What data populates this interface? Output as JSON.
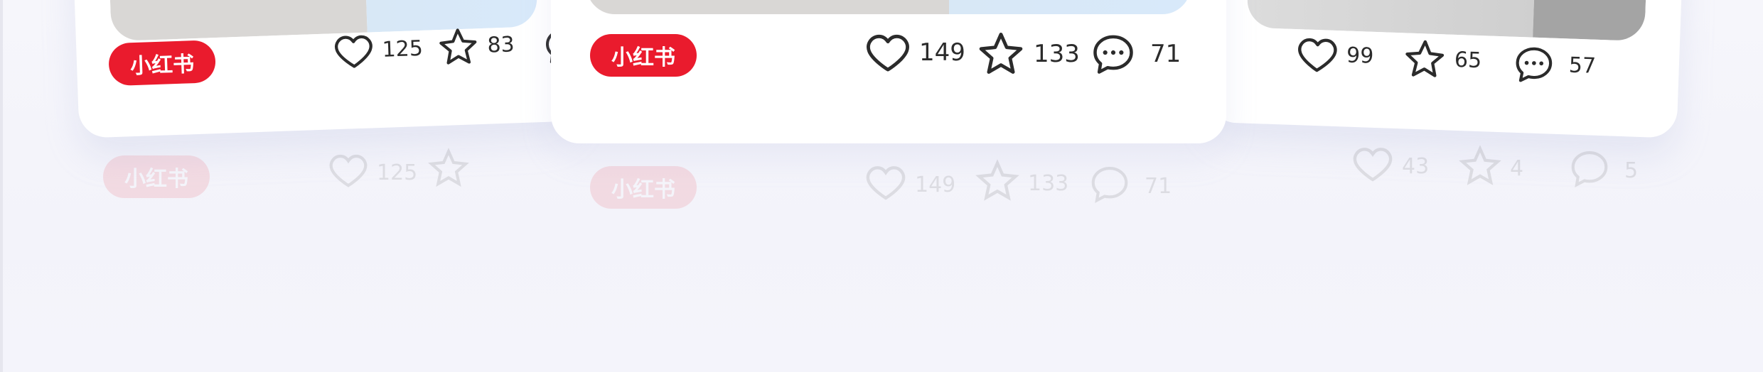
{
  "brand": {
    "logo_text": "小红书",
    "accent_color": "#ea1b2d"
  },
  "cards": {
    "left": {
      "likes": "125",
      "favorites": "83"
    },
    "center": {
      "likes": "149",
      "favorites": "133",
      "comments": "71"
    },
    "right": {
      "likes": "99",
      "favorites": "65",
      "comments": "57"
    }
  },
  "reflections": {
    "left": {
      "likes": "125"
    },
    "center": {
      "likes": "149",
      "favorites": "133",
      "comments": "71"
    },
    "right": {
      "likes": "43",
      "favorites": "4",
      "comments": "5"
    }
  }
}
